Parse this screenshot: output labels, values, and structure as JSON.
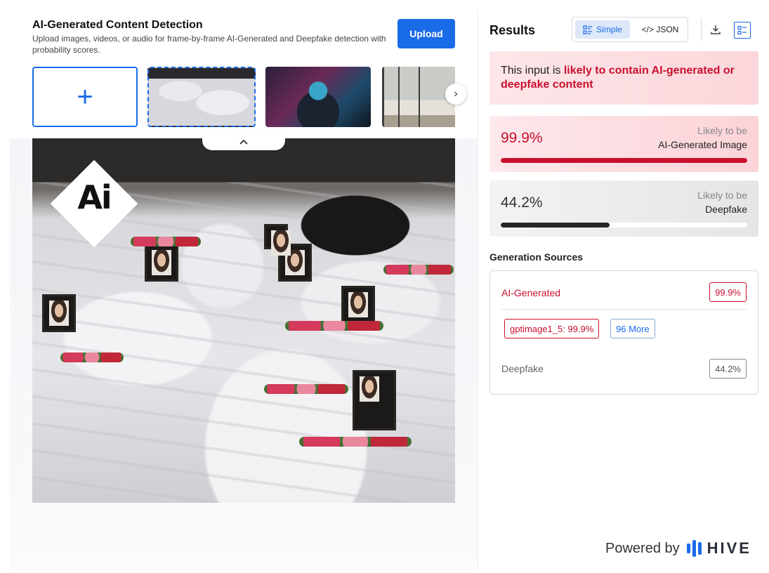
{
  "header": {
    "title": "AI-Generated Content Detection",
    "description": "Upload images, videos, or audio for frame-by-frame AI-Generated and Deepfake detection with probability scores.",
    "upload_label": "Upload"
  },
  "thumbnails": {
    "add_icon": "+",
    "next_icon": "›",
    "collapse_icon": "^"
  },
  "image_overlay": {
    "logo_text": "Ai"
  },
  "results": {
    "title": "Results",
    "view_simple": "Simple",
    "view_json": "</> JSON",
    "verdict_prefix": "This input is ",
    "verdict_emphasis": "likely to contain AI-generated or deepfake content",
    "ai_card": {
      "percent": "99.9%",
      "label_top": "Likely to be",
      "label_bottom": "AI-Generated Image",
      "score": 0.999
    },
    "deepfake_card": {
      "percent": "44.2%",
      "label_top": "Likely to be",
      "label_bottom": "Deepfake",
      "score": 0.442
    }
  },
  "sources": {
    "title": "Generation Sources",
    "ai_label": "AI-Generated",
    "ai_value": "99.9%",
    "model_chip": "gptimage1_5: 99.9%",
    "more_chip": "96 More",
    "deepfake_label": "Deepfake",
    "deepfake_value": "44.2%"
  },
  "footer": {
    "powered_by": "Powered by",
    "brand": "HIVE"
  },
  "colors": {
    "accent": "#1a6be8",
    "danger": "#c8102e",
    "dark_bar": "#262626"
  }
}
